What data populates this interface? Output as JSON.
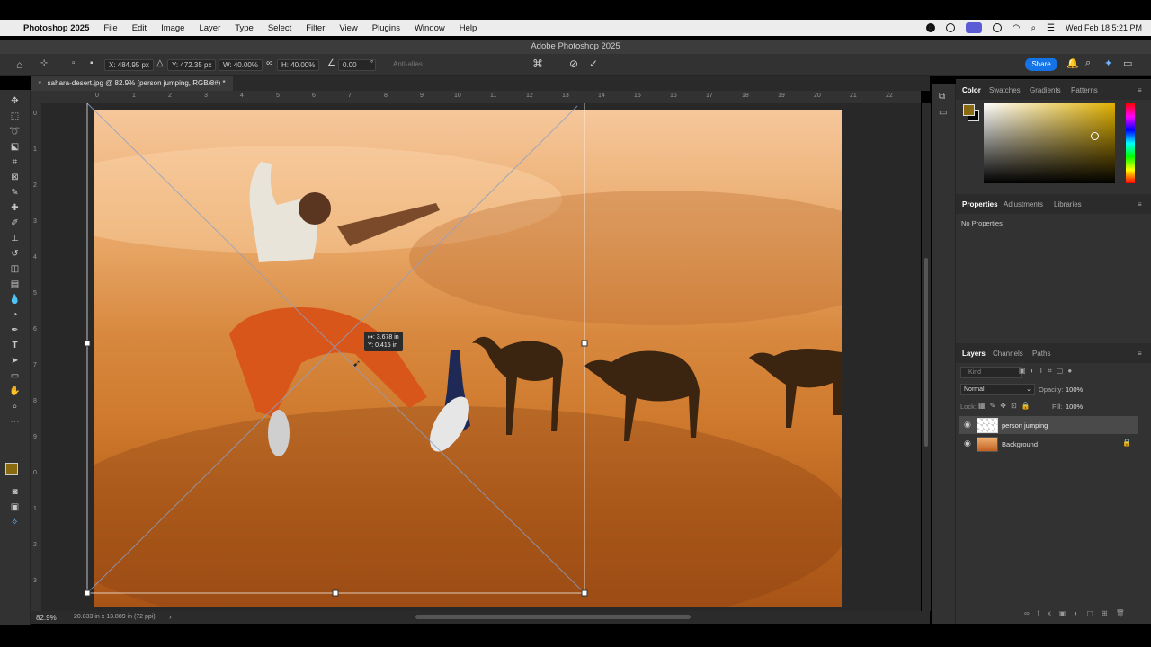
{
  "menubar": {
    "app": "Photoshop 2025",
    "items": [
      "File",
      "Edit",
      "Image",
      "Layer",
      "Type",
      "Select",
      "Filter",
      "View",
      "Plugins",
      "Window",
      "Help"
    ],
    "datetime": "Wed Feb 18  5:21 PM"
  },
  "window": {
    "title": "Adobe Photoshop 2025"
  },
  "options": {
    "x": "X:  484.95 px",
    "y": "Y:  472.35 px",
    "w": "W:  40.00%",
    "h": "H:  40.00%",
    "angle": "0.00",
    "angle_unit": "°",
    "antialias": "Anti-alias",
    "share": "Share"
  },
  "document": {
    "tab": "sahara-desert.jpg @ 82.9% (person jumping, RGB/8#) *"
  },
  "rulers": {
    "top": [
      "0",
      "1",
      "2",
      "3",
      "4",
      "5",
      "6",
      "7",
      "8",
      "9",
      "10",
      "11",
      "12",
      "13",
      "14",
      "15",
      "16",
      "17",
      "18",
      "19",
      "20",
      "21",
      "22"
    ],
    "left": [
      "0",
      "1",
      "2",
      "3",
      "4",
      "5",
      "6",
      "7",
      "8",
      "9",
      "0",
      "1",
      "2",
      "3"
    ]
  },
  "transform_tooltip": {
    "line1": "↦: 3.678 in",
    "line2": "Y: 0.415 in"
  },
  "status": {
    "zoom": "82.9%",
    "info": "20.833 in x 13.889 in (72 ppi)"
  },
  "color_panel": {
    "tabs": [
      "Color",
      "Swatches",
      "Gradients",
      "Patterns"
    ],
    "fg": "#8a6a10"
  },
  "properties_panel": {
    "tabs": [
      "Properties",
      "Adjustments",
      "Libraries"
    ],
    "empty": "No Properties"
  },
  "layers_panel": {
    "tabs": [
      "Layers",
      "Channels",
      "Paths"
    ],
    "kind": "Kind",
    "blend": "Normal",
    "opacity_label": "Opacity:",
    "opacity": "100%",
    "lock": "Lock:",
    "fill_label": "Fill:",
    "fill": "100%",
    "layers": [
      {
        "name": "person jumping"
      },
      {
        "name": "Background"
      }
    ]
  }
}
